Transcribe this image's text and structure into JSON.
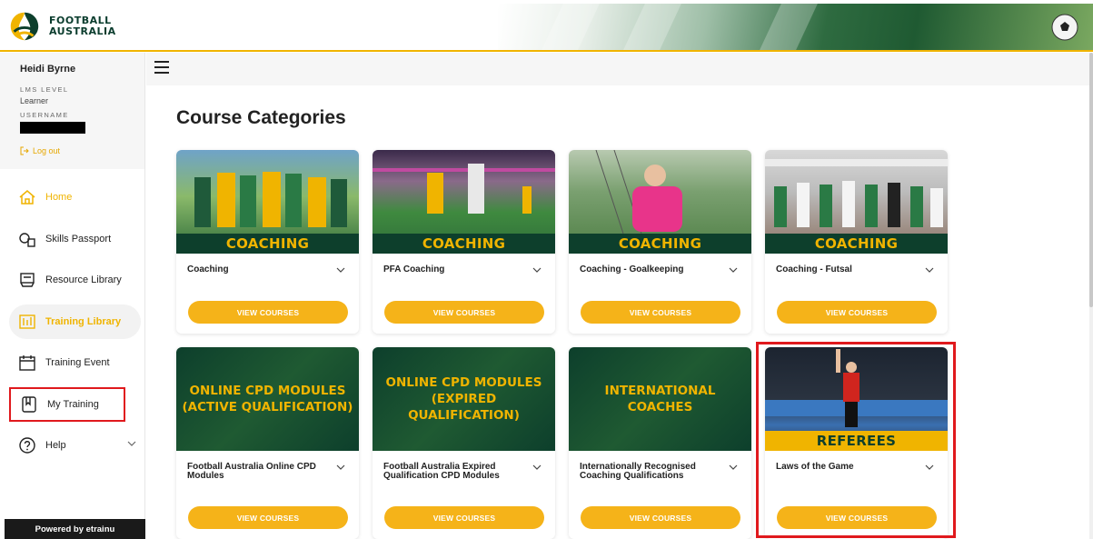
{
  "header": {
    "logo_text_line1": "FOOTBALL",
    "logo_text_line2": "AUSTRALIA"
  },
  "sidebar": {
    "user_name": "Heidi Byrne",
    "lms_level_label": "LMS LEVEL",
    "lms_level_value": "Learner",
    "username_label": "USERNAME",
    "logout_label": "Log out",
    "items": [
      {
        "label": "Home",
        "icon": "home-icon"
      },
      {
        "label": "Skills Passport",
        "icon": "skills-passport-icon"
      },
      {
        "label": "Resource Library",
        "icon": "resource-library-icon"
      },
      {
        "label": "Training Library",
        "icon": "training-library-icon"
      },
      {
        "label": "Training Event",
        "icon": "calendar-icon"
      },
      {
        "label": "My Training",
        "icon": "my-training-icon"
      },
      {
        "label": "Help",
        "icon": "help-icon"
      }
    ],
    "powered_by": "Powered by etrainu"
  },
  "main": {
    "title": "Course Categories",
    "button_label": "VIEW COURSES",
    "cards": [
      {
        "banner": "COACHING",
        "title": "Coaching"
      },
      {
        "banner": "COACHING",
        "title": "PFA Coaching"
      },
      {
        "banner": "COACHING",
        "title": "Coaching - Goalkeeping"
      },
      {
        "banner": "COACHING",
        "title": "Coaching - Futsal"
      },
      {
        "banner": "ONLINE CPD MODULES (ACTIVE QUALIFICATION)",
        "title": "Football Australia Online CPD Modules"
      },
      {
        "banner": "ONLINE CPD MODULES (EXPIRED QUALIFICATION)",
        "title": "Football Australia Expired Qualification CPD Modules"
      },
      {
        "banner": "INTERNATIONAL COACHES",
        "title": "Internationally Recognised Coaching Qualifications"
      },
      {
        "banner": "REFEREES",
        "title": "Laws of the Game"
      }
    ]
  },
  "colors": {
    "accent": "#f0b400",
    "dark_green": "#0d3f2c",
    "highlight_red": "#e0191d"
  }
}
